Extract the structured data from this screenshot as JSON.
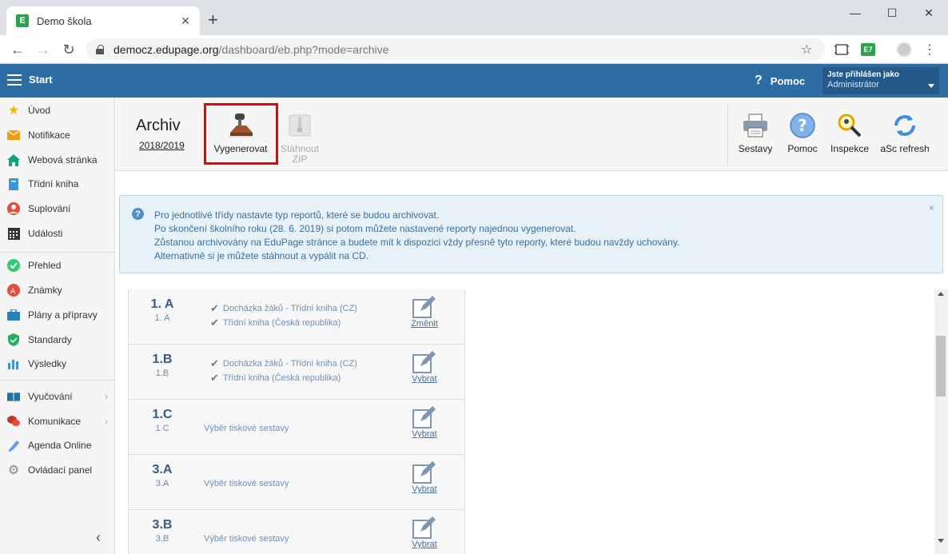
{
  "browser": {
    "tab_title": "Demo škola",
    "favicon_letter": "E",
    "url_domain": "democz.edupage.org",
    "url_path": "/dashboard/eb.php?mode=archive",
    "extension_label": "E7"
  },
  "header": {
    "start_label": "Start",
    "help_label": "Pomoc",
    "logged_in_label": "Jste přihlášen jako",
    "user_role": "Administrátor",
    "bar_color": "#2e6da4"
  },
  "sidebar": {
    "items": [
      {
        "label": "Úvod",
        "icon": "star-icon"
      },
      {
        "label": "Notifikace",
        "icon": "envelope-icon"
      },
      {
        "label": "Webová stránka",
        "icon": "home-icon"
      },
      {
        "label": "Třídní kniha",
        "icon": "book-icon"
      },
      {
        "label": "Suplování",
        "icon": "person-icon"
      },
      {
        "label": "Události",
        "icon": "calendar-icon"
      },
      {
        "label": "Přehled",
        "icon": "check-circle-icon"
      },
      {
        "label": "Známky",
        "icon": "grade-icon"
      },
      {
        "label": "Plány a přípravy",
        "icon": "briefcase-icon"
      },
      {
        "label": "Standardy",
        "icon": "shield-icon"
      },
      {
        "label": "Výsledky",
        "icon": "bar-chart-icon"
      },
      {
        "label": "Vyučování",
        "icon": "open-book-icon"
      },
      {
        "label": "Komunikace",
        "icon": "chat-icon"
      },
      {
        "label": "Agenda Online",
        "icon": "pen-icon"
      },
      {
        "label": "Ovládací panel",
        "icon": "gear-icon"
      }
    ]
  },
  "toolbar": {
    "title": "Archiv",
    "year": "2018/2019",
    "generate_label": "Vygenerovat",
    "download_label_1": "Stáhnout",
    "download_label_2": "ZIP",
    "reports_label": "Sestavy",
    "help_label": "Pomoc",
    "inspect_label": "Inspekce",
    "refresh_label": "aSc refresh"
  },
  "info": {
    "lines": [
      "Pro jednotlivé třídy nastavte typ reportů, které se budou archivovat.",
      "Po skončení školního roku (28. 6. 2019) si potom můžete nastavené reporty najednou vygenerovat.",
      "Zůstanou archivovány na EduPage stránce a budete mít k dispozici vždy přesně tyto reporty, které budou navždy uchovány.",
      "Alternativně si je můžete stáhnout a vypálit na CD."
    ],
    "close_symbol": "×"
  },
  "classes": [
    {
      "name": "1. A",
      "sub": "1. A",
      "reports": [
        "Docházka žáků - Třídní kniha (CZ)",
        "Třídní kniha (Česká republika)"
      ],
      "action": "Změnit"
    },
    {
      "name": "1.B",
      "sub": "1.B",
      "reports": [
        "Docházka žáků - Třídní kniha (CZ)",
        "Třídní kniha (Česká republika)"
      ],
      "action": "Vybrat"
    },
    {
      "name": "1.C",
      "sub": "1.C",
      "reports": [],
      "placeholder": "Výběr tiskové sestavy",
      "action": "Vybrat"
    },
    {
      "name": "3.A",
      "sub": "3.A",
      "reports": [],
      "placeholder": "Výběr tiskové sestavy",
      "action": "Vybrat"
    },
    {
      "name": "3.B",
      "sub": "3.B",
      "reports": [],
      "placeholder": "Výběr tiskové sestavy",
      "action": "Vybrat"
    }
  ]
}
